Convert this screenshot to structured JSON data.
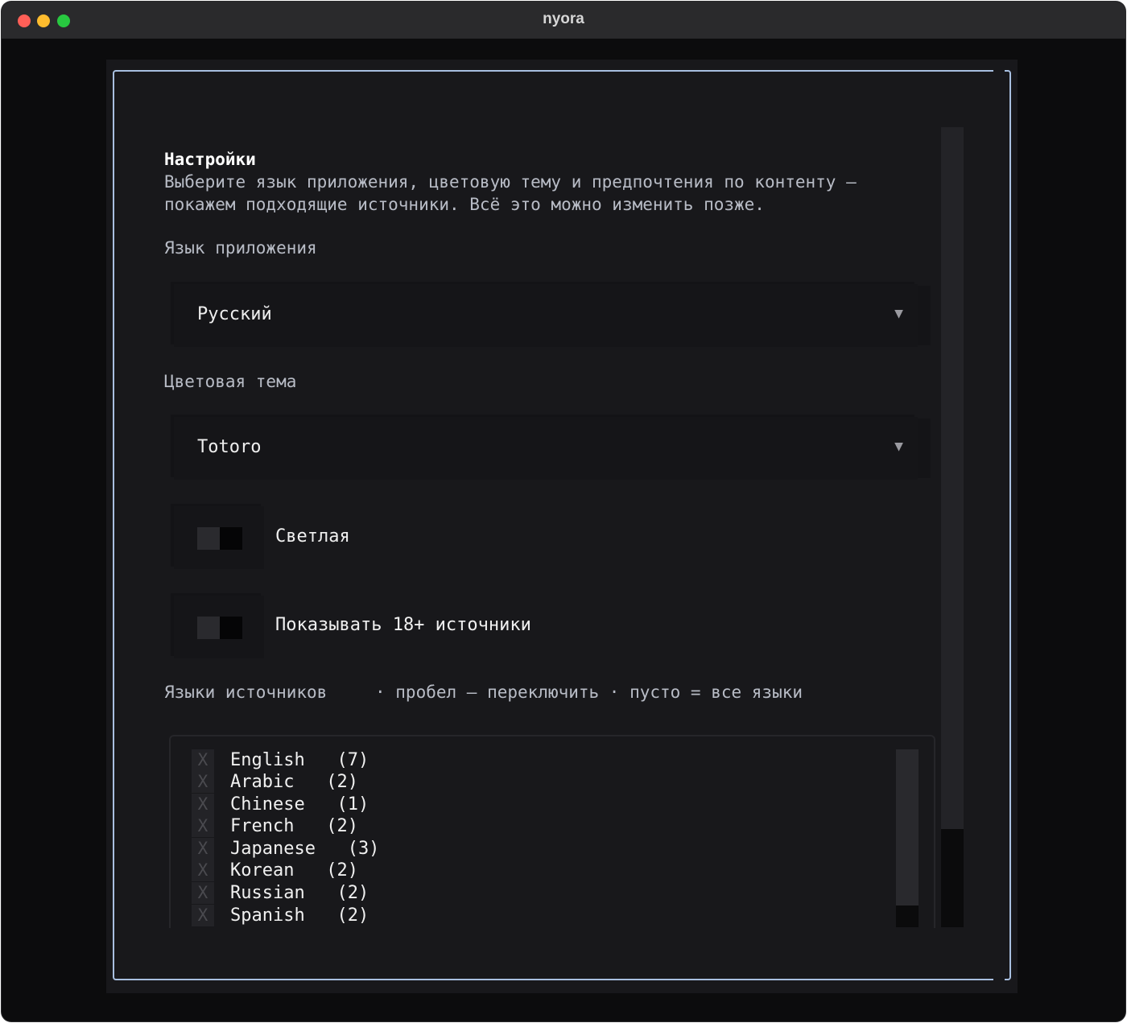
{
  "window": {
    "title": "nyora"
  },
  "settings": {
    "heading": "Настройки",
    "description_line1": "Выберите язык приложения, цветовую тему и предпочтения по контенту —",
    "description_line2": "покажем подходящие источники. Всё это можно изменить позже.",
    "app_language": {
      "label": "Язык приложения",
      "value": "Русский",
      "arrow": "▼"
    },
    "color_theme": {
      "label": "Цветовая тема",
      "value": "Totoro",
      "arrow": "▼"
    },
    "light_toggle": {
      "label": "Светлая",
      "state": "off"
    },
    "adult_toggle": {
      "label": "Показывать 18+ источники",
      "state": "off"
    },
    "source_languages": {
      "label": "Языки источников",
      "hint": "· пробел — переключить · пусто = все языки",
      "items": [
        {
          "mark": "X",
          "name": "English   (7)"
        },
        {
          "mark": "X",
          "name": "Arabic   (2)"
        },
        {
          "mark": "X",
          "name": "Chinese   (1)"
        },
        {
          "mark": "X",
          "name": "French   (2)"
        },
        {
          "mark": "X",
          "name": "Japanese   (3)"
        },
        {
          "mark": "X",
          "name": "Korean   (2)"
        },
        {
          "mark": "X",
          "name": "Russian   (2)"
        },
        {
          "mark": "X",
          "name": "Spanish   (2)"
        }
      ]
    }
  },
  "colors": {
    "frame_border": "#a8bfe0",
    "panel_bg": "#18181b",
    "window_bg": "#0c0c0d",
    "text_primary": "#f0f0f0",
    "text_muted": "#b8bcc6"
  }
}
